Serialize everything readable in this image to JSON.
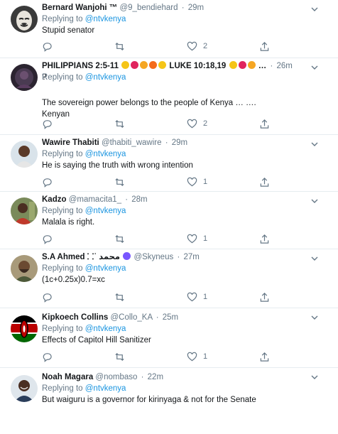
{
  "tweets": [
    {
      "name": "Bernard Wanjohi ™",
      "handle": "@9_bendiehard",
      "time": "29m",
      "replying_label": "Replying to",
      "replying_to": "@ntvkenya",
      "text": [
        "Stupid senator"
      ],
      "likes": "2",
      "avatar": "anonymous-mask-avatar"
    },
    {
      "name": "PHILIPPIANS 2:5-11",
      "name_suffix": "LUKE 10:18,19",
      "name_tail": "…",
      "handle": "",
      "time": "26m",
      "replying_label": "Replying to",
      "replying_to": "@ntvkenya",
      "text": [
        "?",
        "The sovereign power belongs to the people of Kenya … ….",
        "Kenyan"
      ],
      "likes": "2",
      "avatar": "dark-portrait-avatar"
    },
    {
      "name": "Wawire Thabiti",
      "handle": "@thabiti_wawire",
      "time": "29m",
      "replying_label": "Replying to",
      "replying_to": "@ntvkenya",
      "text": [
        "He is saying the truth with wrong intention"
      ],
      "likes": "1",
      "avatar": "man-portrait-avatar"
    },
    {
      "name": "Kadzo",
      "handle": "@mamacita1_",
      "time": "28m",
      "replying_label": "Replying to",
      "replying_to": "@ntvkenya",
      "text": [
        "Malala is right."
      ],
      "likes": "1",
      "avatar": "woman-portrait-avatar"
    },
    {
      "name": "S.A Ahmed",
      "name_extra": "⸬ʿ محمد",
      "handle": "@Skyneus",
      "time": "27m",
      "replying_label": "Replying to",
      "replying_to": "@ntvkenya",
      "text": [
        "(1c+0.25x)0.7=xc"
      ],
      "likes": "1",
      "avatar": "man-beard-avatar"
    },
    {
      "name": "Kipkoech Collins",
      "handle": "@Collo_KA",
      "time": "25m",
      "replying_label": "Replying to",
      "replying_to": "@ntvkenya",
      "text": [
        "Effects of Capitol Hill Sanitizer"
      ],
      "likes": "1",
      "avatar": "kenya-flag-avatar"
    },
    {
      "name": "Noah Magara",
      "handle": "@nombaso",
      "time": "22m",
      "replying_label": "Replying to",
      "replying_to": "@ntvkenya",
      "text": [
        "But waiguru is a governor for kirinyaga & not for the Senate"
      ],
      "likes": "",
      "avatar": "man-smiling-avatar"
    }
  ],
  "colors": {
    "link": "#1b95e0",
    "muted": "#657786",
    "border": "#e6ecf0",
    "text": "#14171a"
  },
  "icons": [
    "reply-icon",
    "retweet-icon",
    "like-icon",
    "share-icon",
    "chevron-down-icon"
  ]
}
